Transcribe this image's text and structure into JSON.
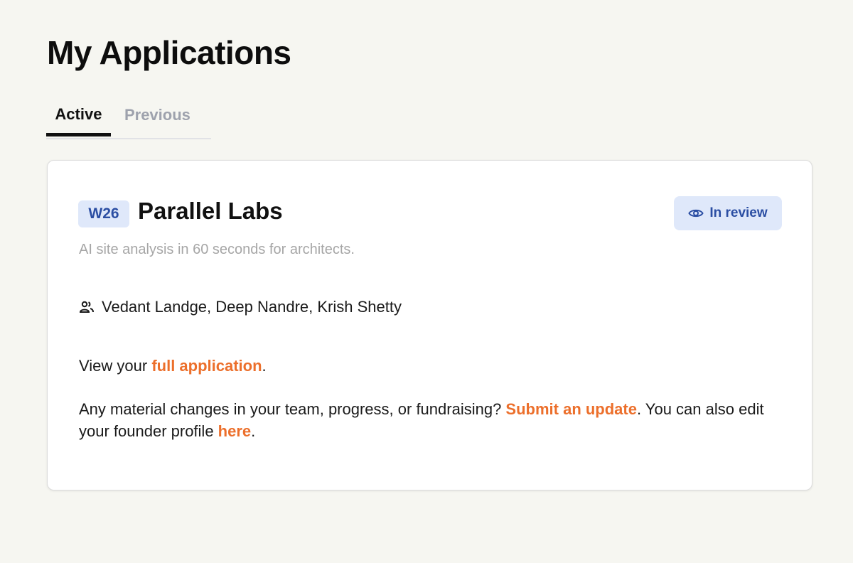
{
  "page": {
    "title": "My Applications"
  },
  "tabs": [
    {
      "label": "Active",
      "active": true
    },
    {
      "label": "Previous",
      "active": false
    }
  ],
  "application": {
    "batch": "W26",
    "company": "Parallel Labs",
    "status": {
      "label": "In review",
      "icon": "eye-icon"
    },
    "tagline": "AI site analysis in 60 seconds for architects.",
    "founders_icon": "people-icon",
    "founders": "Vedant Landge, Deep Nandre, Krish Shetty",
    "view_text_before": "View your ",
    "view_link": "full application",
    "view_text_after": ".",
    "changes_text_before": "Any material changes in your team, progress, or fundraising? ",
    "changes_link": "Submit an update",
    "changes_text_middle": ". You can also edit your founder profile ",
    "profile_link": "here",
    "changes_text_after": "."
  },
  "colors": {
    "background": "#f6f6f1",
    "accent_link": "#ec6f2b",
    "badge_bg": "#dfe8fa",
    "badge_text": "#2b4ea3",
    "muted_text": "#a6a6a6"
  }
}
